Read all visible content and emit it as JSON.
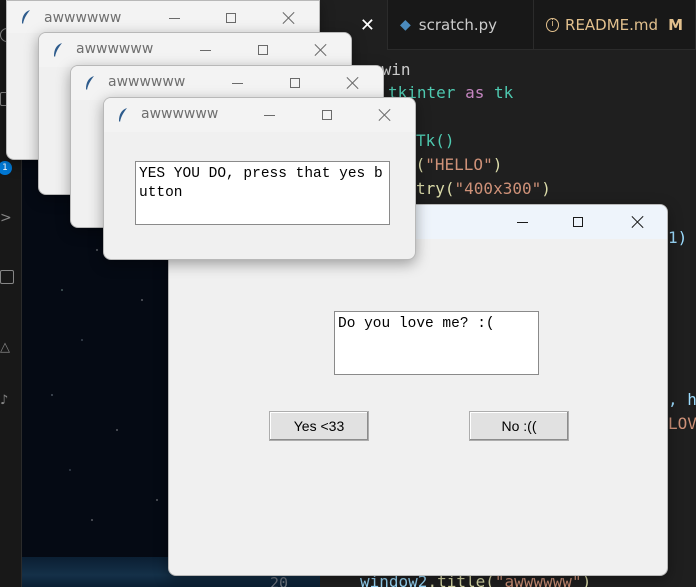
{
  "vscode": {
    "tabs": [
      {
        "label": "",
        "close": "✕"
      },
      {
        "label": "scratch.py"
      },
      {
        "label": "README.md",
        "status": "M"
      }
    ],
    "badge": "1",
    "line_number": "20",
    "code": {
      "l1": "_win",
      "l2_a": "tkinter",
      "l2_b": "as",
      "l2_c": "tk",
      "l3": "Tk()",
      "l4_a": "e(",
      "l4_b": "\"HELLO\"",
      "l4_c": ")",
      "l5_a": "try(",
      "l5_b": "\"400x300\"",
      "l5_c": ")",
      "l6": "1)",
      "l7": ", h",
      "l8": "LOV",
      "bottom_a": "window2",
      "bottom_b": ".title(",
      "bottom_c": "\"awwwwww\"",
      "bottom_d": ")"
    }
  },
  "main_window": {
    "title": "",
    "question": "Do you love me? :(",
    "yes_button": "Yes <33",
    "no_button": "No :(("
  },
  "popups": [
    {
      "title": "awwwwww"
    },
    {
      "title": "awwwwww"
    },
    {
      "title": "awwwwww"
    },
    {
      "title": "awwwwww",
      "message": "YES YOU DO, press that yes button"
    }
  ],
  "colors": {
    "tk_bg": "#f0f0f0",
    "vscode_bg": "#1f1f1f",
    "readme_modified": "#e2c08d"
  }
}
